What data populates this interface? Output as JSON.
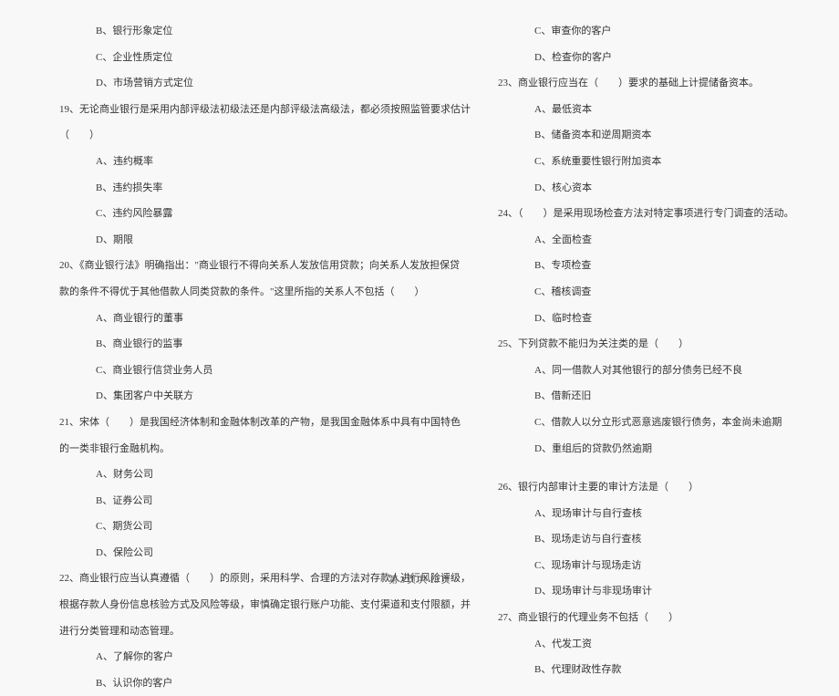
{
  "left": {
    "opt_b_18": "B、银行形象定位",
    "opt_c_18": "C、企业性质定位",
    "opt_d_18": "D、市场营销方式定位",
    "q19_a": "19、无论商业银行是采用内部评级法初级法还是内部评级法高级法，都必须按照监管要求估计",
    "q19_b": "（　　）",
    "opt_a_19": "A、违约概率",
    "opt_b_19": "B、违约损失率",
    "opt_c_19": "C、违约风险暴露",
    "opt_d_19": "D、期限",
    "q20_a": "20、《商业银行法》明确指出：\"商业银行不得向关系人发放信用贷款；向关系人发放担保贷",
    "q20_b": "款的条件不得优于其他借款人同类贷款的条件。\"这里所指的关系人不包括（　　）",
    "opt_a_20": "A、商业银行的董事",
    "opt_b_20": "B、商业银行的监事",
    "opt_c_20": "C、商业银行信贷业务人员",
    "opt_d_20": "D、集团客户中关联方",
    "q21_a": "21、宋体（　　）是我国经济体制和金融体制改革的产物，是我国金融体系中具有中国特色",
    "q21_b": "的一类非银行金融机构。",
    "opt_a_21": "A、财务公司",
    "opt_b_21": "B、证券公司",
    "opt_c_21": "C、期货公司",
    "opt_d_21": "D、保险公司",
    "q22_a": "22、商业银行应当认真遵循（　　）的原则，采用科学、合理的方法对存款人进行风险评级，",
    "q22_b": "根据存款人身份信息核验方式及风险等级，审慎确定银行账户功能、支付渠道和支付限额，并",
    "q22_c": "进行分类管理和动态管理。",
    "opt_a_22": "A、了解你的客户",
    "opt_b_22": "B、认识你的客户"
  },
  "right": {
    "opt_c_22": "C、审查你的客户",
    "opt_d_22": "D、检查你的客户",
    "q23": "23、商业银行应当在（　　）要求的基础上计提储备资本。",
    "opt_a_23": "A、最低资本",
    "opt_b_23": "B、储备资本和逆周期资本",
    "opt_c_23": "C、系统重要性银行附加资本",
    "opt_d_23": "D、核心资本",
    "q24": "24、（　　）是采用现场检查方法对特定事项进行专门调查的活动。",
    "opt_a_24": "A、全面检查",
    "opt_b_24": "B、专项检查",
    "opt_c_24": "C、稽核调查",
    "opt_d_24": "D、临时检查",
    "q25": "25、下列贷款不能归为关注类的是（　　）",
    "opt_a_25": "A、同一借款人对其他银行的部分债务已经不良",
    "opt_b_25": "B、借新还旧",
    "opt_c_25": "C、借款人以分立形式恶意逃废银行债务，本金尚未逾期",
    "opt_d_25": "D、重组后的贷款仍然逾期",
    "q26": "26、银行内部审计主要的审计方法是（　　）",
    "opt_a_26": "A、现场审计与自行查核",
    "opt_b_26": "B、现场走访与自行查核",
    "opt_c_26": "C、现场审计与现场走访",
    "opt_d_26": "D、现场审计与非现场审计",
    "q27": "27、商业银行的代理业务不包括（　　）",
    "opt_a_27": "A、代发工资",
    "opt_b_27": "B、代理财政性存款"
  },
  "footer": "第 3 页 共 18 页"
}
